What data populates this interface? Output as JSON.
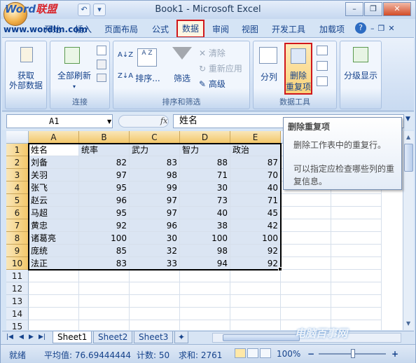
{
  "app": {
    "window_title": "Book1 - Microsoft Excel",
    "logo_text_a": "Word",
    "logo_text_b": "联盟",
    "site_url": "www.wordlm.com"
  },
  "quick_access": {
    "undo": "↶",
    "customize": "▾"
  },
  "window_controls": {
    "minimize": "–",
    "restore": "❐",
    "close": "✕"
  },
  "tabs": [
    "开始",
    "插入",
    "页面布局",
    "公式",
    "数据",
    "审阅",
    "视图",
    "开发工具",
    "加载项"
  ],
  "active_tab": "数据",
  "ribbon": {
    "external": {
      "label_line1": "获取",
      "label_line2": "外部数据"
    },
    "connections": {
      "refresh_line1": "全部刷新",
      "group_label": "连接"
    },
    "sort_filter": {
      "sort_label": "排序...",
      "filter_label": "筛选",
      "clear_label": "清除",
      "reapply_label": "重新应用",
      "advanced_label": "高级",
      "az_label": "A Z",
      "group_label": "排序和筛选"
    },
    "data_tools": {
      "text_to_columns": "分列",
      "remove_dup_line1": "删除",
      "remove_dup_line2": "重复项",
      "group_label": "数据工具"
    },
    "outline": {
      "label": "分级显示"
    }
  },
  "formula_bar": {
    "name_box": "A1",
    "fx": "fx",
    "content": "姓名"
  },
  "sheet": {
    "columns": [
      "A",
      "B",
      "C",
      "D",
      "E",
      "F",
      "G"
    ],
    "rows": [
      [
        "姓名",
        "统率",
        "武力",
        "智力",
        "政治"
      ],
      [
        "刘备",
        "82",
        "83",
        "88",
        "87"
      ],
      [
        "关羽",
        "97",
        "98",
        "71",
        "70"
      ],
      [
        "张飞",
        "95",
        "99",
        "30",
        "40"
      ],
      [
        "赵云",
        "96",
        "97",
        "73",
        "71"
      ],
      [
        "马超",
        "95",
        "97",
        "40",
        "45"
      ],
      [
        "黄忠",
        "92",
        "96",
        "38",
        "42"
      ],
      [
        "诸葛亮",
        "100",
        "30",
        "100",
        "100"
      ],
      [
        "庞统",
        "85",
        "32",
        "98",
        "92"
      ],
      [
        "法正",
        "83",
        "33",
        "94",
        "92"
      ]
    ],
    "row_numbers": [
      "1",
      "2",
      "3",
      "4",
      "5",
      "6",
      "7",
      "8",
      "9",
      "10",
      "11",
      "12",
      "13",
      "14",
      "15"
    ]
  },
  "tooltip": {
    "title": "删除重复项",
    "line1": "删除工作表中的重复行。",
    "line2": "可以指定应检查哪些列的重复信息。"
  },
  "sheet_tabs": [
    "Sheet1",
    "Sheet2",
    "Sheet3"
  ],
  "active_sheet": "Sheet1",
  "status": {
    "ready": "就绪",
    "average": "平均值: 76.69444444",
    "count": "计数: 50",
    "sum": "求和: 2761",
    "zoom": "100%"
  },
  "watermark": "电脑百事网"
}
